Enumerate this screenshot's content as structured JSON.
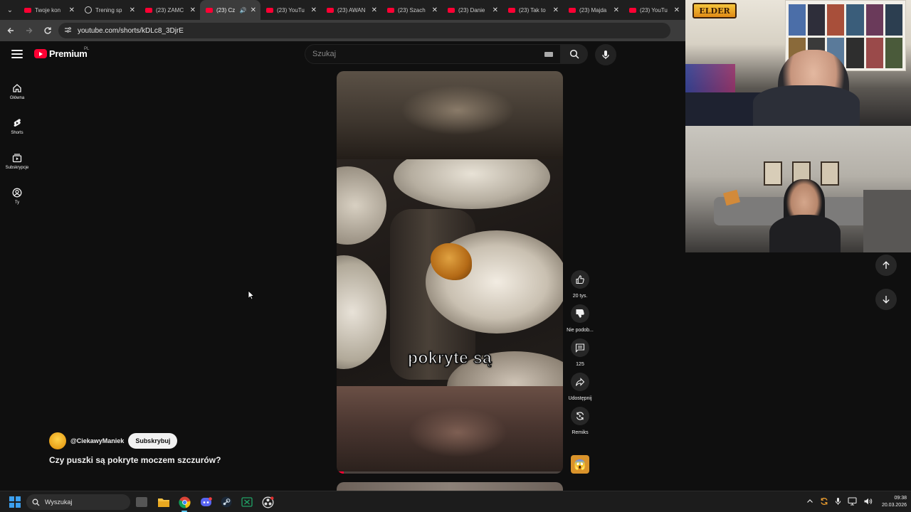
{
  "browser": {
    "tabs": [
      {
        "title": "Twoje kon",
        "favicon": "youtube-icon"
      },
      {
        "title": "Trening sp",
        "favicon": "globe-icon"
      },
      {
        "title": "(23) ZAMC",
        "favicon": "youtube-icon"
      },
      {
        "title": "(23) Cz",
        "favicon": "youtube-icon",
        "active": true
      },
      {
        "title": "(23) YouTu",
        "favicon": "youtube-icon"
      },
      {
        "title": "(23) AWAN",
        "favicon": "youtube-icon"
      },
      {
        "title": "(23) Szach",
        "favicon": "youtube-icon"
      },
      {
        "title": "(23) Danie",
        "favicon": "youtube-icon"
      },
      {
        "title": "(23) Tak to",
        "favicon": "youtube-icon"
      },
      {
        "title": "(23) Majda",
        "favicon": "youtube-icon"
      },
      {
        "title": "(23) YouTu",
        "favicon": "youtube-icon"
      }
    ],
    "url": "youtube.com/shorts/kDLc8_3DjrE"
  },
  "youtube": {
    "logo_text": "Premium",
    "logo_region": "PL",
    "search_placeholder": "Szukaj",
    "rail": [
      {
        "label": "Główna",
        "icon": "home-icon"
      },
      {
        "label": "Shorts",
        "icon": "shorts-icon"
      },
      {
        "label": "Subskrypcje",
        "icon": "subscriptions-icon"
      },
      {
        "label": "Ty",
        "icon": "you-icon"
      }
    ],
    "video": {
      "caption": "pokryte są",
      "progress_fraction": 0.03
    },
    "actions": {
      "like_count": "20 tys.",
      "dislike_label": "Nie podob...",
      "comments_count": "125",
      "share_label": "Udostępnij",
      "remix_label": "Remiks"
    },
    "channel": {
      "handle": "@CiekawyManiek",
      "subscribe_label": "Subskrybuj"
    },
    "video_title": "Czy puszki są pokryte moczem szczurów?"
  },
  "overlay": {
    "brand_text": "ELDER"
  },
  "taskbar": {
    "search_placeholder": "Wyszukaj",
    "time": "09:38",
    "date": "20.03.2026"
  },
  "colors": {
    "youtube_red": "#ff0033",
    "background": "#0f0f0f",
    "accent_blue": "#60cdff"
  }
}
